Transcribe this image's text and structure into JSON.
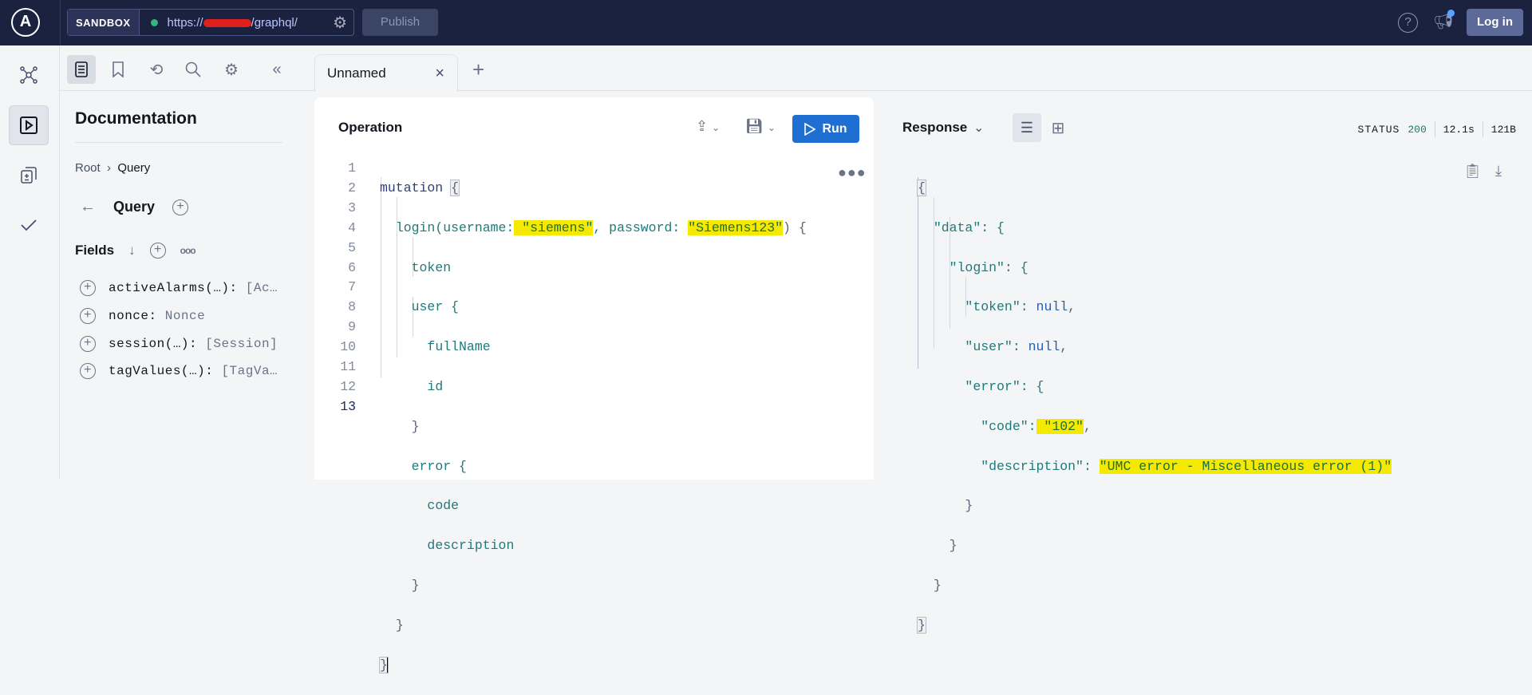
{
  "header": {
    "logo": "A",
    "sandbox_label": "SANDBOX",
    "url_prefix": "https://",
    "url_suffix": "/graphql/",
    "publish_label": "Publish",
    "help": "?",
    "login_label": "Log in"
  },
  "tabs": [
    {
      "label": "Unnamed",
      "close": "×"
    }
  ],
  "tab_add": "+",
  "docs": {
    "title": "Documentation",
    "breadcrumb": [
      "Root",
      "Query"
    ],
    "breadcrumb_sep": "›",
    "type_name": "Query",
    "fields_label": "Fields",
    "more": "ooo",
    "fields": [
      {
        "name": "activeAlarms(…):",
        "type": "[Ac…"
      },
      {
        "name": "nonce:",
        "type": "Nonce"
      },
      {
        "name": "session(…):",
        "type": "[Session]"
      },
      {
        "name": "tagValues(…):",
        "type": "[TagVa…"
      }
    ]
  },
  "operation": {
    "title": "Operation",
    "run_label": "Run",
    "line_numbers": [
      "1",
      "2",
      "3",
      "4",
      "5",
      "6",
      "7",
      "8",
      "9",
      "10",
      "11",
      "12",
      "13"
    ],
    "code": {
      "l1_kw": "mutation",
      "l2a": "login(username:",
      "l2_user": " \"siemens\"",
      "l2b": ", password: ",
      "l2_pass": "\"Siemens123\"",
      "l2c": ") {",
      "l3": "token",
      "l4": "user {",
      "l5": "fullName",
      "l6": "id",
      "l7": "}",
      "l8": "error {",
      "l9": "code",
      "l10": "description",
      "l11": "}",
      "l12": "}",
      "l13": "}",
      "open": "{"
    }
  },
  "response": {
    "title": "Response",
    "status_label": "STATUS",
    "status_code": "200",
    "time": "12.1s",
    "size": "121B",
    "json": {
      "open": "{",
      "data_key": "\"data\": {",
      "login_key": "\"login\": {",
      "token_key": "\"token\": ",
      "token_val": "null",
      "user_key": "\"user\": ",
      "user_val": "null",
      "error_key": "\"error\": {",
      "code_key": "\"code\":",
      "code_val": " \"102\"",
      "desc_key": "\"description\": ",
      "desc_val": "\"UMC error - Miscellaneous error (1)\"",
      "comma": ",",
      "close": "}"
    }
  }
}
